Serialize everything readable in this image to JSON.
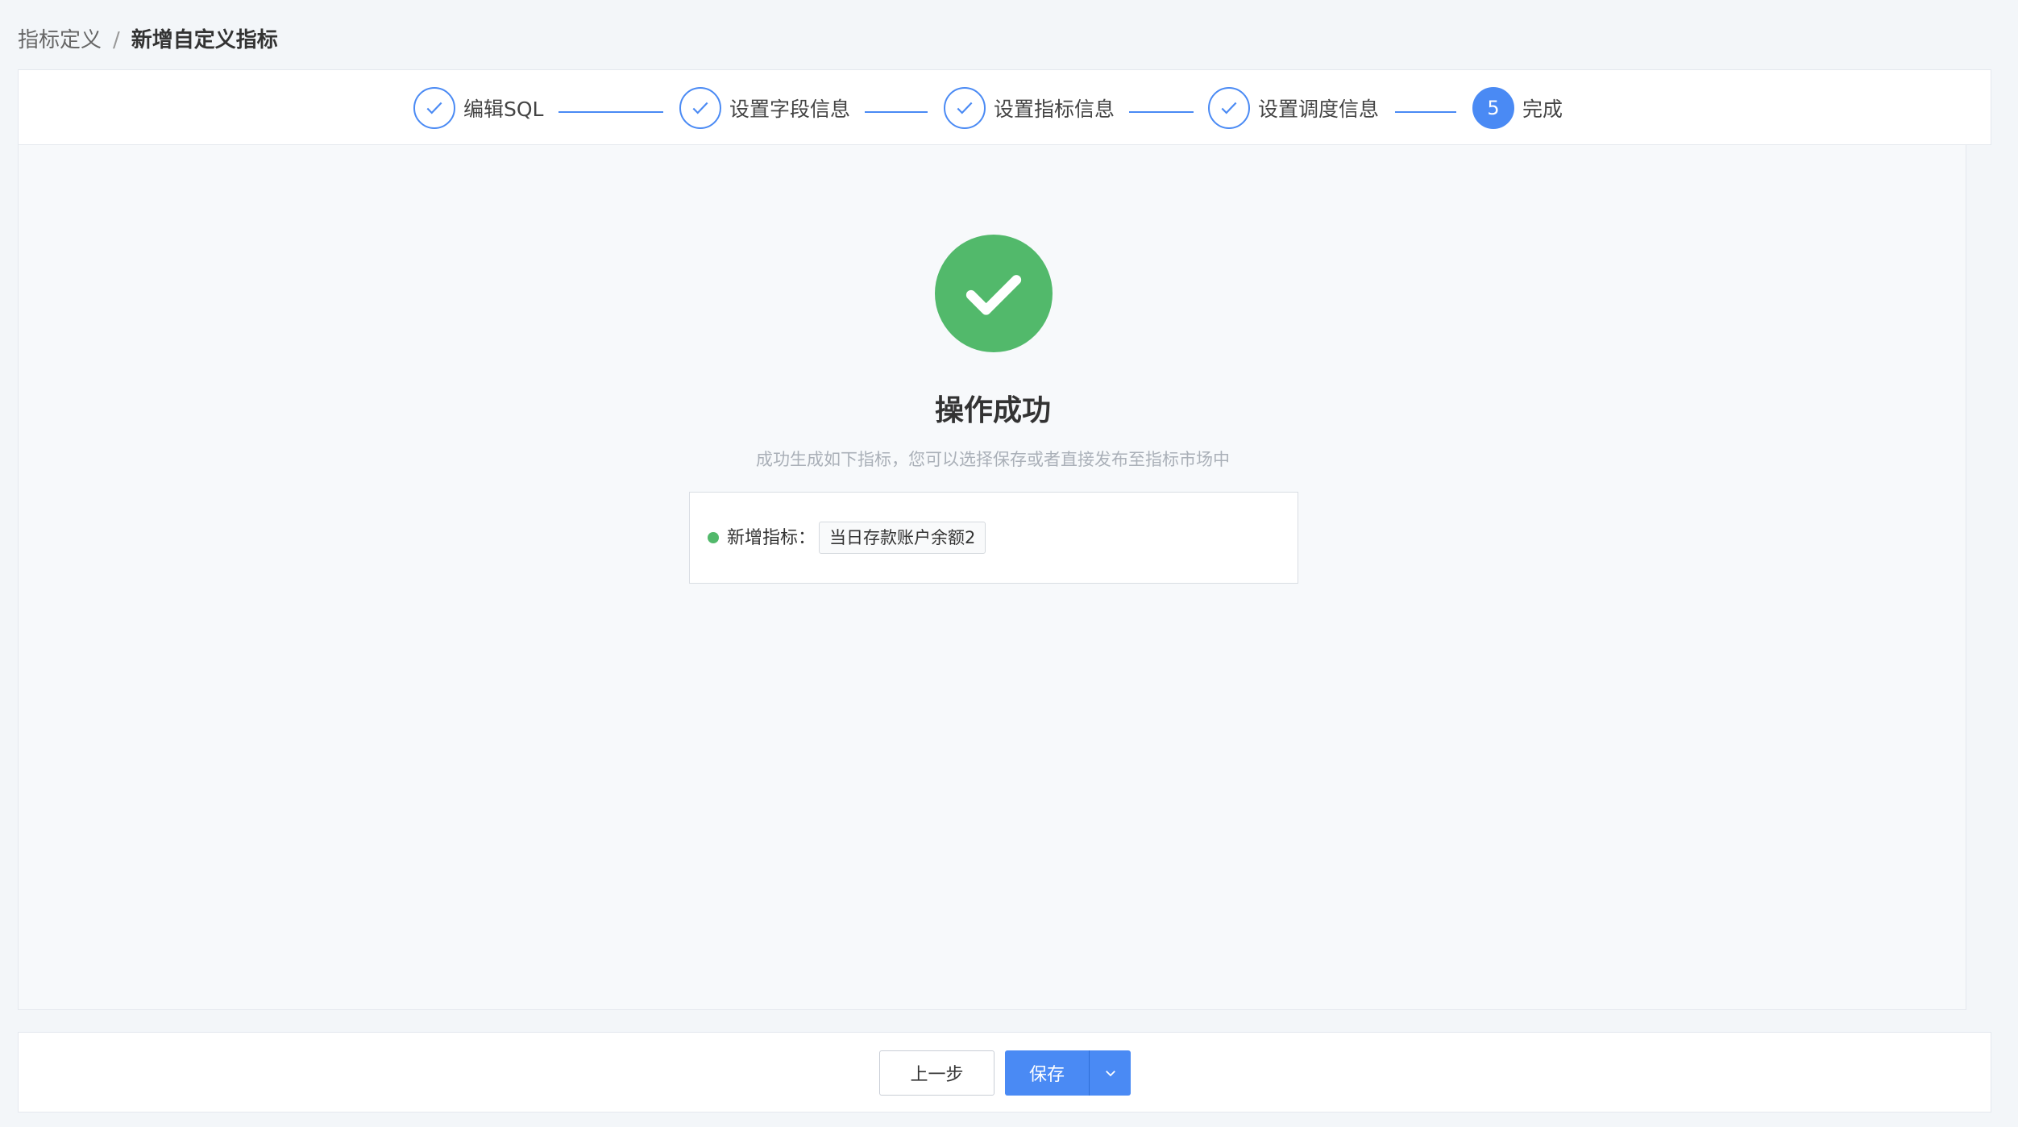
{
  "breadcrumb": {
    "parent": "指标定义",
    "separator": "/",
    "current": "新增自定义指标"
  },
  "steps": [
    {
      "label": "编辑SQL",
      "state": "done",
      "icon": "check-icon"
    },
    {
      "label": "设置字段信息",
      "state": "done",
      "icon": "check-icon"
    },
    {
      "label": "设置指标信息",
      "state": "done",
      "icon": "check-icon"
    },
    {
      "label": "设置调度信息",
      "state": "done",
      "icon": "check-icon"
    },
    {
      "label": "完成",
      "state": "active",
      "number": "5"
    }
  ],
  "result": {
    "icon": "success-check-icon",
    "title": "操作成功",
    "description": "成功生成如下指标，您可以选择保存或者直接发布至指标市场中",
    "metric_label": "新增指标：",
    "metric_name": "当日存款账户余额2"
  },
  "footer": {
    "prev_label": "上一步",
    "save_label": "保存",
    "dropdown_icon": "chevron-down-icon"
  },
  "colors": {
    "primary": "#4a8af4",
    "success": "#52b96b",
    "background": "#f3f6f9"
  }
}
